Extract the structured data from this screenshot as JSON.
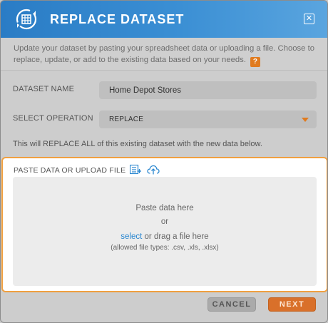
{
  "dialog": {
    "title": "REPLACE DATASET",
    "close_label": "✕",
    "intro_text": "Update your dataset by pasting your spreadsheet data or uploading a file. Choose to replace, update, or add to the existing data based on your needs.",
    "help_label": "?"
  },
  "form": {
    "dataset_name_label": "DATASET NAME",
    "dataset_name_value": "Home Depot Stores",
    "operation_label": "SELECT OPERATION",
    "operation_value": "REPLACE",
    "warning_text": "This will REPLACE ALL of this existing dataset with the new data below."
  },
  "upload": {
    "label": "PASTE DATA OR UPLOAD FILE",
    "paste_text": "Paste data here",
    "or_text": "or",
    "select_link": "select",
    "drag_text": " or drag a file here",
    "allowed_types": "(allowed file types: .csv, .xls, .xlsx)"
  },
  "footer": {
    "cancel_label": "CANCEL",
    "next_label": "NEXT"
  },
  "colors": {
    "header_blue": "#2a7cc5",
    "accent_orange": "#e07b1f",
    "link_blue": "#2a87d0"
  }
}
